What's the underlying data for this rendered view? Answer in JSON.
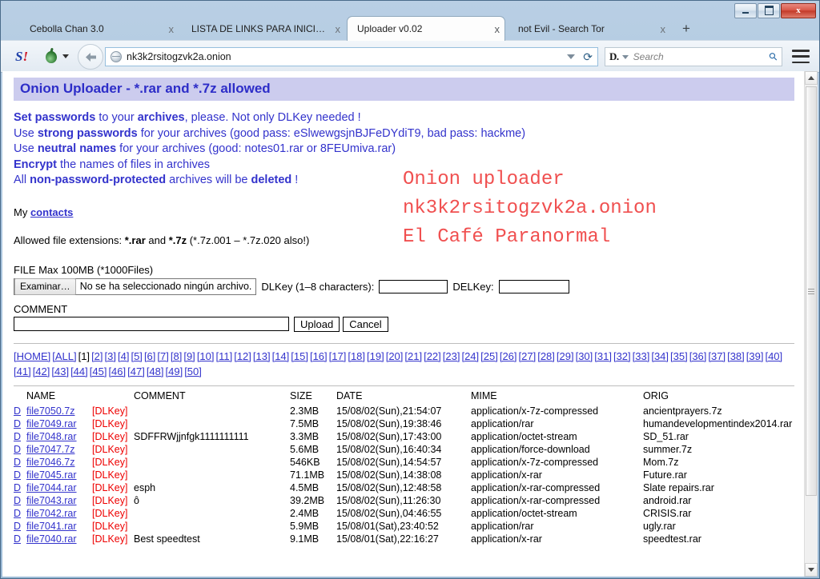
{
  "window": {
    "controls": {
      "minimize": "–",
      "maximize": "□",
      "close": "x"
    }
  },
  "tabs": [
    {
      "title": "Cebolla Chan 3.0",
      "active": false,
      "close": "x"
    },
    {
      "title": "LISTA DE LINKS PARA INICIAR...",
      "active": false,
      "close": "x"
    },
    {
      "title": "Uploader v0.02",
      "active": true,
      "close": "x"
    },
    {
      "title": "not Evil - Search Tor",
      "active": false,
      "close": "x"
    }
  ],
  "newtab_label": "+",
  "toolbar": {
    "scriptblock_icon": "s-bang-icon",
    "scriptblock_text": "S",
    "scriptblock_bang": "!",
    "tor_icon": "onion-icon",
    "back_icon": "back-arrow-icon",
    "url": "nk3k2rsitogzvk2a.onion",
    "url_dropdown_icon": "chevron-down-icon",
    "reload_icon": "⟳",
    "search_engine": "D.",
    "search_placeholder": "Search",
    "search_icon": "⚲",
    "menu_icon": "hamburger-icon"
  },
  "page": {
    "banner": "Onion Uploader - *.rar and *.7z allowed",
    "instructions": [
      [
        {
          "t": "Set passwords",
          "b": true
        },
        {
          "t": " to your ",
          "b": false
        },
        {
          "t": "archives",
          "b": true
        },
        {
          "t": ", please. Not only DLKey needed !",
          "b": false
        }
      ],
      [
        {
          "t": "Use ",
          "b": false
        },
        {
          "t": "strong passwords",
          "b": true
        },
        {
          "t": " for your archives (good pass: eSlwewgsjnBJFeDYdiT9, bad pass: hackme)",
          "b": false
        }
      ],
      [
        {
          "t": "Use ",
          "b": false
        },
        {
          "t": "neutral names",
          "b": true
        },
        {
          "t": " for your archives (good: notes01.rar or 8FEUmiva.rar)",
          "b": false
        }
      ],
      [
        {
          "t": "Encrypt",
          "b": true
        },
        {
          "t": " the names of files in archives",
          "b": false
        }
      ],
      [
        {
          "t": "All ",
          "b": false
        },
        {
          "t": "non-password-protected",
          "b": true
        },
        {
          "t": " archives will be ",
          "b": false
        },
        {
          "t": "deleted",
          "b": true
        },
        {
          "t": " !",
          "b": false
        }
      ]
    ],
    "red_block": "Onion uploader\nnk3k2rsitogzvk2a.onion\nEl Café Paranormal",
    "contacts_prefix": "My ",
    "contacts_link": "contacts",
    "allowed": [
      {
        "t": "Allowed file extensions: ",
        "b": false
      },
      {
        "t": "*.rar",
        "b": true
      },
      {
        "t": " and ",
        "b": false
      },
      {
        "t": "*.7z",
        "b": true
      },
      {
        "t": " (*.7z.001 – *.7z.020 also!)",
        "b": false
      }
    ],
    "file_max": "FILE Max 100MB (*1000Files)",
    "browse_button": "Examinar…",
    "file_chosen": "No se ha seleccionado ningún archivo.",
    "dlkey_label": "DLKey (1–8 characters):",
    "dlkey_value": "",
    "delkey_label": "DELKey:",
    "delkey_value": "",
    "comment_label": "COMMENT",
    "comment_value": "",
    "upload_button": "Upload",
    "cancel_button": "Cancel"
  },
  "pager": {
    "home": "[HOME]",
    "all": "[ALL]",
    "current": "[1]",
    "pages": [
      "[2]",
      "[3]",
      "[4]",
      "[5]",
      "[6]",
      "[7]",
      "[8]",
      "[9]",
      "[10]",
      "[11]",
      "[12]",
      "[13]",
      "[14]",
      "[15]",
      "[16]",
      "[17]",
      "[18]",
      "[19]",
      "[20]",
      "[21]",
      "[22]",
      "[23]",
      "[24]",
      "[25]",
      "[26]",
      "[27]",
      "[28]",
      "[29]",
      "[30]",
      "[31]",
      "[32]",
      "[33]",
      "[34]",
      "[35]",
      "[36]",
      "[37]",
      "[38]",
      "[39]",
      "[40]",
      "[41]",
      "[42]",
      "[43]",
      "[44]",
      "[45]",
      "[46]",
      "[47]",
      "[48]",
      "[49]",
      "[50]"
    ]
  },
  "table": {
    "headers": {
      "d": "",
      "name": "NAME",
      "comment": "COMMENT",
      "size": "SIZE",
      "date": "DATE",
      "mime": "MIME",
      "orig": "ORIG"
    },
    "rows": [
      {
        "d": "D",
        "name": "file7050.7z",
        "dlkey": "[DLKey]",
        "comment": "",
        "size": "2.3MB",
        "date": "15/08/02(Sun),21:54:07",
        "mime": "application/x-7z-compressed",
        "orig": "ancientprayers.7z"
      },
      {
        "d": "D",
        "name": "file7049.rar",
        "dlkey": "[DLKey]",
        "comment": "",
        "size": "7.5MB",
        "date": "15/08/02(Sun),19:38:46",
        "mime": "application/rar",
        "orig": "humandevelopmentindex2014.rar"
      },
      {
        "d": "D",
        "name": "file7048.rar",
        "dlkey": "[DLKey]",
        "comment": "SDFFRWjjnfgk1111111111",
        "size": "3.3MB",
        "date": "15/08/02(Sun),17:43:00",
        "mime": "application/octet-stream",
        "orig": "SD_51.rar"
      },
      {
        "d": "D",
        "name": "file7047.7z",
        "dlkey": "[DLKey]",
        "comment": "",
        "size": "5.6MB",
        "date": "15/08/02(Sun),16:40:34",
        "mime": "application/force-download",
        "orig": "summer.7z"
      },
      {
        "d": "D",
        "name": "file7046.7z",
        "dlkey": "[DLKey]",
        "comment": "",
        "size": "546KB",
        "date": "15/08/02(Sun),14:54:57",
        "mime": "application/x-7z-compressed",
        "orig": "Mom.7z"
      },
      {
        "d": "D",
        "name": "file7045.rar",
        "dlkey": "[DLKey]",
        "comment": "",
        "size": "71.1MB",
        "date": "15/08/02(Sun),14:38:08",
        "mime": "application/x-rar",
        "orig": "Future.rar"
      },
      {
        "d": "D",
        "name": "file7044.rar",
        "dlkey": "[DLKey]",
        "comment": "esph",
        "size": "4.5MB",
        "date": "15/08/02(Sun),12:48:58",
        "mime": "application/x-rar-compressed",
        "orig": "Slate repairs.rar"
      },
      {
        "d": "D",
        "name": "file7043.rar",
        "dlkey": "[DLKey]",
        "comment": "ô",
        "size": "39.2MB",
        "date": "15/08/02(Sun),11:26:30",
        "mime": "application/x-rar-compressed",
        "orig": "android.rar"
      },
      {
        "d": "D",
        "name": "file7042.rar",
        "dlkey": "[DLKey]",
        "comment": "",
        "size": "2.4MB",
        "date": "15/08/02(Sun),04:46:55",
        "mime": "application/octet-stream",
        "orig": "CRISIS.rar"
      },
      {
        "d": "D",
        "name": "file7041.rar",
        "dlkey": "[DLKey]",
        "comment": "",
        "size": "5.9MB",
        "date": "15/08/01(Sat),23:40:52",
        "mime": "application/rar",
        "orig": "ugly.rar"
      },
      {
        "d": "D",
        "name": "file7040.rar",
        "dlkey": "[DLKey]",
        "comment": "Best speedtest",
        "size": "9.1MB",
        "date": "15/08/01(Sat),22:16:27",
        "mime": "application/x-rar",
        "orig": "speedtest.rar"
      }
    ]
  }
}
